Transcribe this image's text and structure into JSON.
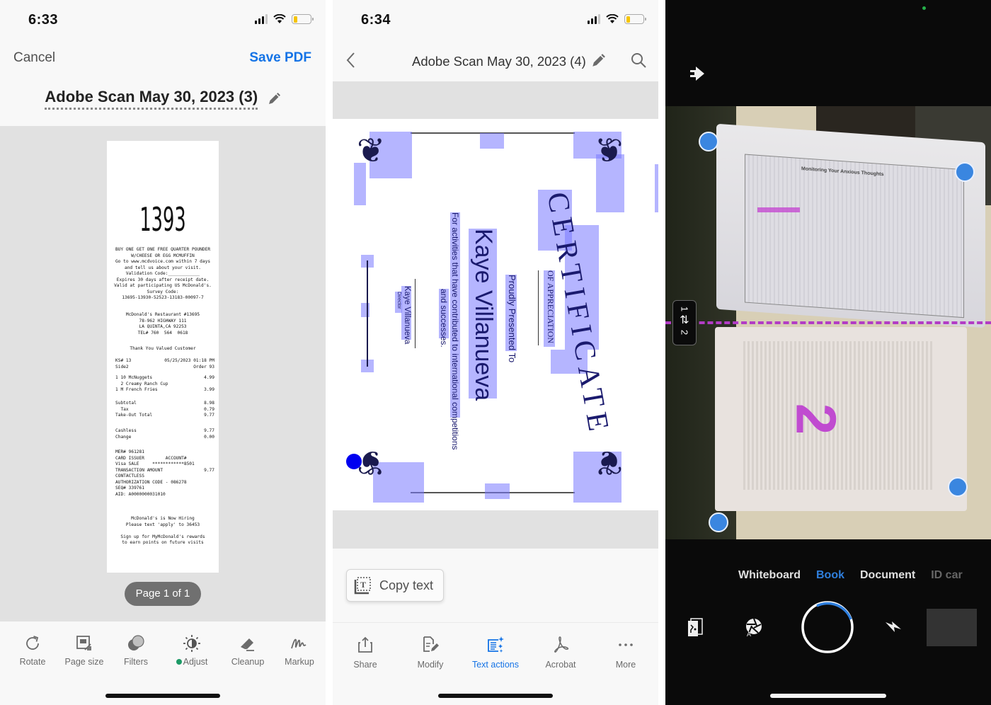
{
  "panel1": {
    "status": {
      "time": "6:33",
      "battery_percent": 15
    },
    "nav": {
      "cancel_label": "Cancel",
      "save_label": "Save PDF"
    },
    "document_title": "Adobe Scan May 30, 2023 (3)",
    "receipt": {
      "order_number": "1393",
      "promo_lines": [
        "BUY ONE GET ONE FREE QUARTER POUNDER",
        "W/CHEESE OR EGG MCMUFFIN",
        "Go to www.mcdvoice.com within 7 days",
        "and tell us about your visit.",
        "Validation Code:____________",
        "Expires 30 days after receipt date.",
        "Valid at participating US McDonald's.",
        "Survey Code:",
        "13695-13930-52523-13183-00097-7"
      ],
      "store_lines": [
        "McDonald's Restaurant #13695",
        "78-962 HIGHWAY 111",
        "LA QUINTA,CA 92253",
        "TEL# 760  564  0618"
      ],
      "greeting": "Thank You Valued Customer",
      "header_rows": [
        [
          "KS# 13",
          "05/25/2023 01:18 PM"
        ],
        [
          "Side2",
          "Order 93"
        ]
      ],
      "item_rows": [
        [
          "1 10 McNuggets",
          "4.99"
        ],
        [
          "  2 Creamy Ranch Cup",
          ""
        ],
        [
          "1 M French Fries",
          "3.99"
        ]
      ],
      "total_rows": [
        [
          "Subtotal",
          "8.98"
        ],
        [
          "  Tax",
          "0.79"
        ],
        [
          "Take-Out Total",
          "9.77"
        ]
      ],
      "payment_rows": [
        [
          "Cashless",
          "9.77"
        ],
        [
          "Change",
          "0.00"
        ]
      ],
      "card_rows": [
        [
          "MER# 961281",
          ""
        ],
        [
          "CARD ISSUER        ACCOUNT#",
          ""
        ],
        [
          "Visa SALE     ************8501",
          ""
        ],
        [
          "TRANSACTION AMOUNT",
          "9.77"
        ],
        [
          "CONTACTLESS",
          ""
        ],
        [
          "AUTHORIZATION CODE - 086278",
          ""
        ],
        [
          "SEQ# 339761",
          ""
        ],
        [
          "AID: A0000000031010",
          ""
        ]
      ],
      "footer_lines": [
        "McDonald's is Now Hiring",
        "Please text 'apply' to 36453",
        "",
        "Sign up for MyMcDonald's rewards",
        "to earn points on future visits"
      ]
    },
    "page_indicator": "Page 1 of 1",
    "toolbar": [
      {
        "label": "Rotate",
        "icon": "rotate-icon"
      },
      {
        "label": "Page size",
        "icon": "page-size-icon"
      },
      {
        "label": "Filters",
        "icon": "filters-icon"
      },
      {
        "label": "Adjust",
        "icon": "adjust-icon",
        "badge": "green-dot"
      },
      {
        "label": "Cleanup",
        "icon": "eraser-icon"
      },
      {
        "label": "Markup",
        "icon": "markup-icon"
      }
    ]
  },
  "panel2": {
    "status": {
      "time": "6:34",
      "battery_percent": 15
    },
    "document_title": "Adobe Scan May 30, 2023 (4)",
    "certificate": {
      "heading": "CERTIFICATE",
      "subheading": "OF APPRECIATION",
      "presented": "Proudly Presented To",
      "recipient": "Kaye Villanueva",
      "description_line1": "For activities that have contributed to international competitions",
      "description_line2": "and successes.",
      "signer": "Kaye Villanueva",
      "signer_title": "Director"
    },
    "copy_text_label": "Copy text",
    "toolbar": [
      {
        "label": "Share",
        "icon": "share-icon"
      },
      {
        "label": "Modify",
        "icon": "modify-icon"
      },
      {
        "label": "Text actions",
        "icon": "text-actions-icon",
        "active": true
      },
      {
        "label": "Acrobat",
        "icon": "acrobat-icon"
      },
      {
        "label": "More",
        "icon": "more-icon"
      }
    ],
    "accent_color": "#1473e6"
  },
  "panel3": {
    "page_order": {
      "top": "1",
      "bottom": "2"
    },
    "page_marker": "2",
    "scanned_page_title": "Monitoring Your Anxious Thoughts",
    "modes": [
      {
        "label": "Whiteboard"
      },
      {
        "label": "Book",
        "active": true
      },
      {
        "label": "Document"
      },
      {
        "label": "ID car"
      }
    ],
    "accent_color": "#2f7fdd"
  }
}
